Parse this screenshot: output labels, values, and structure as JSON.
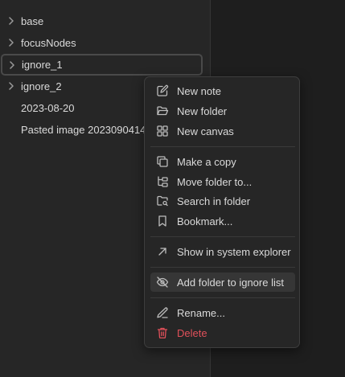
{
  "tree": {
    "items": [
      {
        "label": "base",
        "icon": "chevron-right-icon"
      },
      {
        "label": "focusNodes",
        "icon": "chevron-right-icon"
      },
      {
        "label": "ignore_1",
        "icon": "chevron-right-icon"
      },
      {
        "label": "ignore_2",
        "icon": "chevron-right-icon"
      },
      {
        "label": "2023-08-20"
      },
      {
        "label": "Pasted image 2023090414"
      }
    ]
  },
  "context_menu": {
    "new_note": "New note",
    "new_folder": "New folder",
    "new_canvas": "New canvas",
    "make_copy": "Make a copy",
    "move_folder": "Move folder to...",
    "search_folder": "Search in folder",
    "bookmark": "Bookmark...",
    "show_explorer": "Show in system explorer",
    "ignore_list": "Add folder to ignore list",
    "rename": "Rename...",
    "delete": "Delete"
  },
  "colors": {
    "danger": "#e0505a",
    "text": "#dadada",
    "highlight": "#363636"
  }
}
